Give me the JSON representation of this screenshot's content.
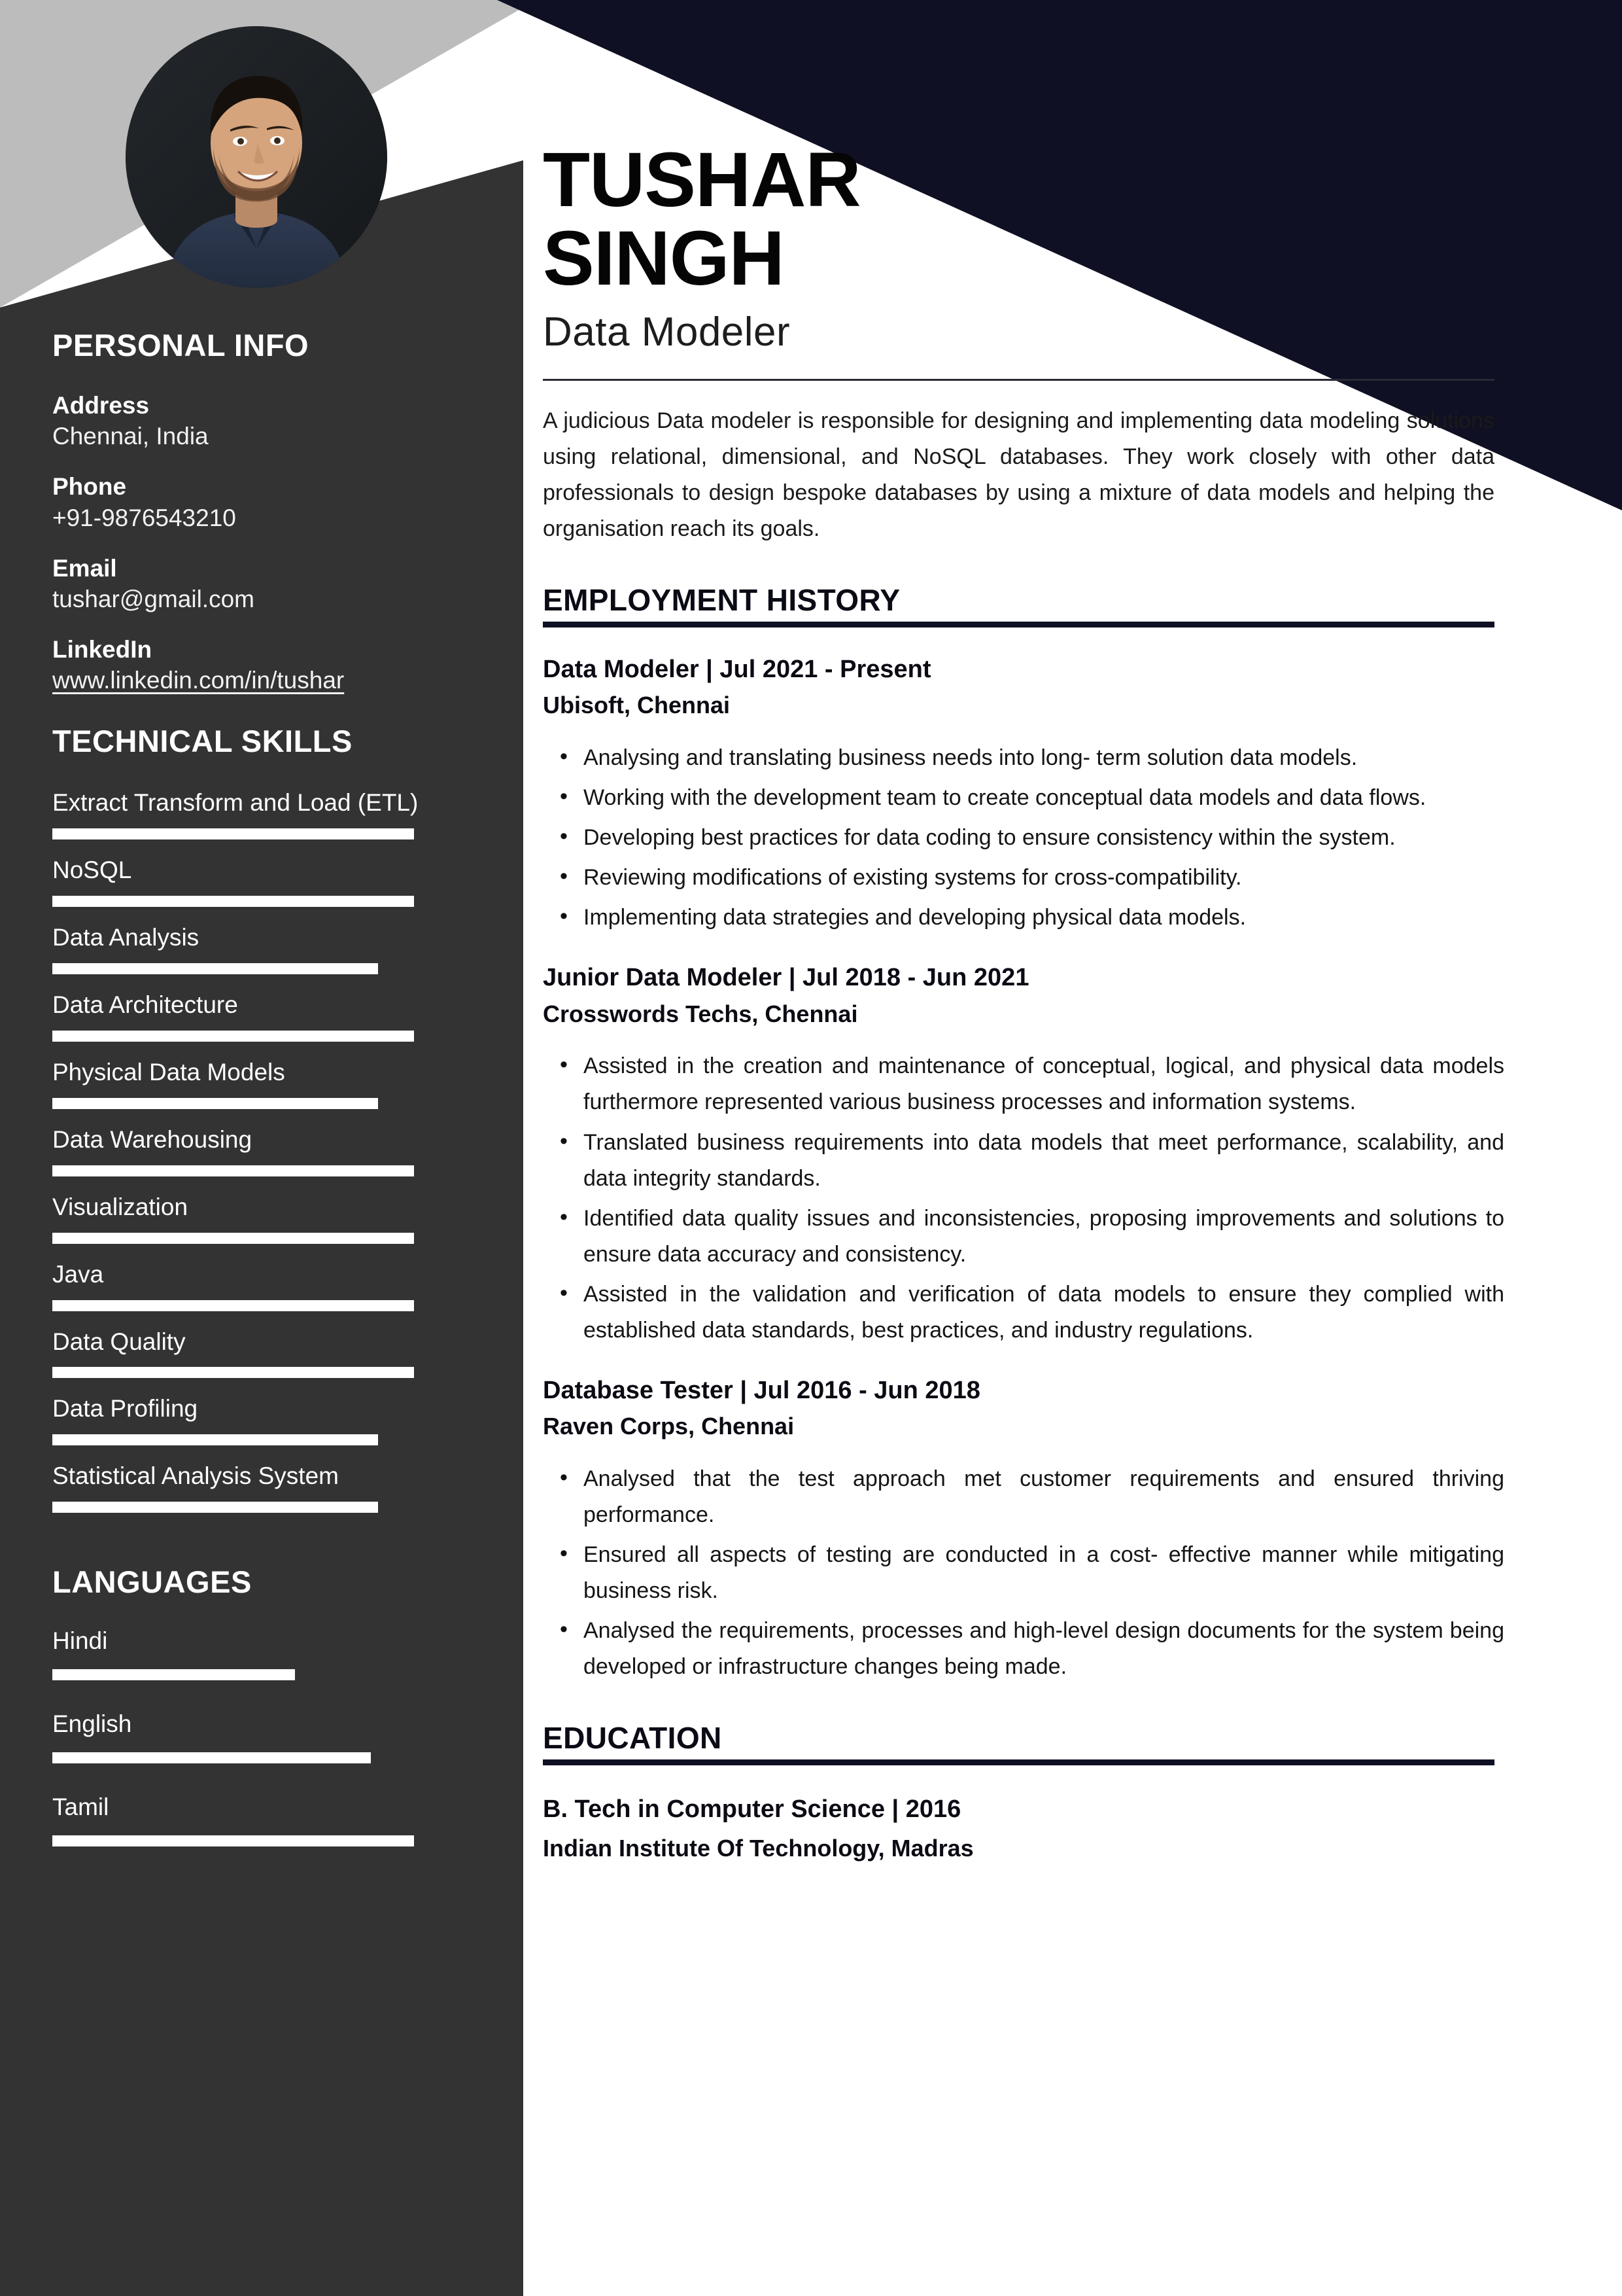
{
  "theme": {
    "sidebar_bg": "#333333",
    "grey_band": "#bcbcbc",
    "navy_band": "#101024",
    "accent_rule": "#101024",
    "text_light": "#ffffff"
  },
  "header": {
    "first_name": "TUSHAR",
    "last_name": "SINGH",
    "role": "Data Modeler",
    "photo_alt": "profile-photo"
  },
  "summary": "A judicious Data modeler is responsible for designing and implementing data modeling solutions using relational, dimensional, and NoSQL databases. They work closely with other data professionals to design bespoke databases by using a mixture of data models and helping the organisation reach its goals.",
  "sidebar": {
    "personal_info": {
      "heading": "PERSONAL INFO",
      "items": [
        {
          "label": "Address",
          "value": "Chennai, India"
        },
        {
          "label": "Phone",
          "value": "+91-9876543210"
        },
        {
          "label": "Email",
          "value": "tushar@gmail.com"
        },
        {
          "label": "LinkedIn",
          "value": "www.linkedin.com/in/tushar"
        }
      ]
    },
    "technical_skills": {
      "heading": "TECHNICAL SKILLS",
      "items": [
        {
          "name": "Extract Transform and Load (ETL)",
          "level": 100
        },
        {
          "name": "NoSQL",
          "level": 100
        },
        {
          "name": "Data Analysis",
          "level": 90
        },
        {
          "name": "Data Architecture",
          "level": 100
        },
        {
          "name": "Physical Data Models",
          "level": 90
        },
        {
          "name": "Data Warehousing",
          "level": 100
        },
        {
          "name": "Visualization",
          "level": 100
        },
        {
          "name": "Java",
          "level": 100
        },
        {
          "name": "Data Quality",
          "level": 100
        },
        {
          "name": "Data Profiling",
          "level": 90
        },
        {
          "name": "Statistical Analysis System",
          "level": 90
        }
      ]
    },
    "languages": {
      "heading": "LANGUAGES",
      "items": [
        {
          "name": "Hindi",
          "level": 67
        },
        {
          "name": "English",
          "level": 88
        },
        {
          "name": "Tamil",
          "level": 100
        }
      ]
    }
  },
  "employment": {
    "heading": "EMPLOYMENT HISTORY",
    "jobs": [
      {
        "title": "Data Modeler | Jul 2021 - Present",
        "org": "Ubisoft, Chennai",
        "bullets": [
          "Analysing and translating business needs into long- term solution data models.",
          "Working with the development team to create conceptual data models and data flows.",
          "Developing best practices for data coding to ensure consistency within the system.",
          "Reviewing modifications of existing systems for cross-compatibility.",
          "Implementing data strategies and developing physical data models."
        ]
      },
      {
        "title": "Junior Data Modeler | Jul 2018 - Jun 2021",
        "org": "Crosswords Techs, Chennai",
        "bullets": [
          "Assisted in the creation and maintenance of conceptual, logical, and physical data models furthermore represented various business processes and information systems.",
          "Translated business requirements into data models that meet performance, scalability, and data integrity standards.",
          "Identified data quality issues and inconsistencies, proposing improvements and solutions to ensure data accuracy and consistency.",
          "Assisted in the validation and verification of data models to ensure they complied with established data standards, best practices, and industry regulations."
        ]
      },
      {
        "title": "Database Tester | Jul 2016 - Jun 2018",
        "org": "Raven Corps, Chennai",
        "bullets": [
          "Analysed that the test approach met customer requirements and ensured thriving performance.",
          "Ensured all aspects of testing are conducted in a cost- effective manner while mitigating business risk.",
          "Analysed the requirements, processes and high-level design documents for the system being developed or infrastructure changes being made."
        ]
      }
    ]
  },
  "education": {
    "heading": "EDUCATION",
    "entries": [
      {
        "degree": "B. Tech in Computer Science | 2016",
        "institution": "Indian Institute Of Technology, Madras"
      }
    ]
  }
}
